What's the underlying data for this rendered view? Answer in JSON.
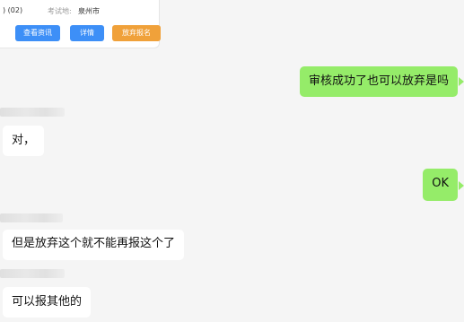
{
  "card": {
    "code": ") (02)",
    "location_label": "考试地:",
    "location_value": "泉州市",
    "buttons": {
      "info": "查看资讯",
      "detail": "详情",
      "abandon": "放弃报名"
    }
  },
  "messages": [
    {
      "side": "right",
      "text": "审核成功了也可以放弃是吗"
    },
    {
      "side": "left",
      "text": "对，"
    },
    {
      "side": "right",
      "text": "OK"
    },
    {
      "side": "left",
      "text": "但是放弃这个就不能再报这个了"
    },
    {
      "side": "left",
      "text": "可以报其他的"
    }
  ],
  "colors": {
    "background": "#f5f5f5",
    "self_bubble": "#95ec69",
    "other_bubble": "#ffffff",
    "primary_button": "#3d8ff7",
    "warning_button": "#f0a13a"
  }
}
